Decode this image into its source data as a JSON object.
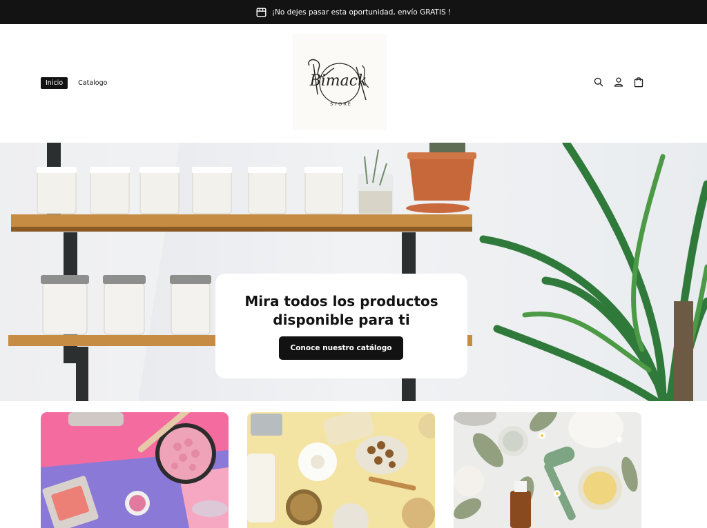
{
  "announcement": {
    "text": "¡No dejes pasar esta oportunidad, envío GRATIS !"
  },
  "nav": {
    "items": [
      {
        "label": "Inicio",
        "active": true
      },
      {
        "label": "Catalogo",
        "active": false
      }
    ]
  },
  "logo": {
    "text": "Bimack",
    "sub": "STORE"
  },
  "header_icons": [
    "search-icon",
    "account-icon",
    "cart-icon"
  ],
  "hero": {
    "title_line1": "Mira todos los productos",
    "title_line2": "disponible para ti",
    "button_label": "Conoce nuestro catálogo"
  },
  "collections": [
    {
      "name": "makeup-collection-card",
      "accent": "#f26aa0"
    },
    {
      "name": "pantry-collection-card",
      "accent": "#f3e3a3"
    },
    {
      "name": "skincare-collection-card",
      "accent": "#ececec"
    }
  ],
  "colors": {
    "topbar": "#131313",
    "button": "#121212",
    "background": "#ffffff"
  }
}
